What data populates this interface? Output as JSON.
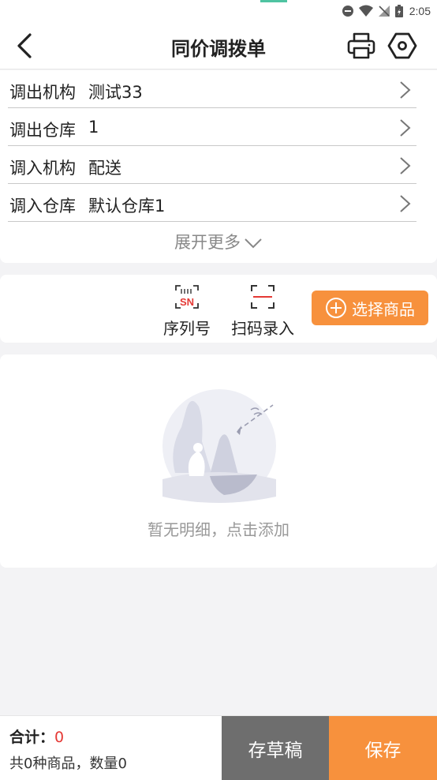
{
  "status_bar": {
    "time": "2:05"
  },
  "header": {
    "title": "同价调拨单"
  },
  "form": {
    "rows": [
      {
        "label": "调出机构",
        "value": "测试33"
      },
      {
        "label": "调出仓库",
        "value": "1"
      },
      {
        "label": "调入机构",
        "value": "配送"
      },
      {
        "label": "调入仓库",
        "value": "默认仓库1"
      }
    ],
    "expand_more": "展开更多"
  },
  "actions": {
    "serial_icon_text": "SN",
    "serial_label": "序列号",
    "scan_label": "扫码录入",
    "select_label": "选择商品"
  },
  "empty": {
    "text": "暂无明细，点击添加"
  },
  "footer": {
    "total_label": "合计：",
    "total_value": "0",
    "summary": "共0种商品，数量0",
    "draft_label": "存草稿",
    "save_label": "保存"
  },
  "colors": {
    "accent": "#f7913d",
    "draft": "#6e6e6e",
    "total_value": "#e53935"
  }
}
